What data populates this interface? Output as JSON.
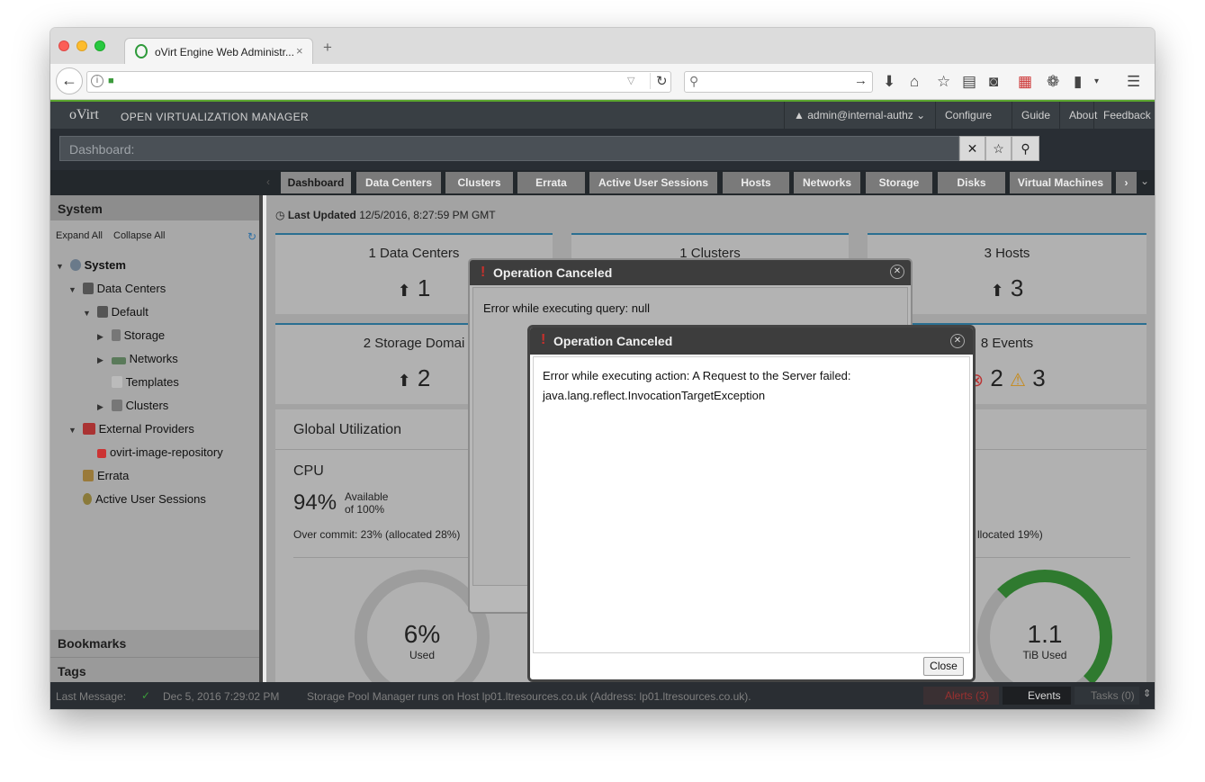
{
  "browser": {
    "tab_title": "oVirt Engine Web Administr...",
    "tab_close": "×",
    "new_tab": "+",
    "reload": "C"
  },
  "header": {
    "logo": "oVirt",
    "title": "OPEN VIRTUALIZATION MANAGER",
    "user": "admin@internal-authz",
    "links": [
      "Configure",
      "Guide",
      "About",
      "Feedback"
    ]
  },
  "search": {
    "placeholder": "Dashboard:"
  },
  "main_tabs": [
    "Dashboard",
    "Data Centers",
    "Clusters",
    "Errata",
    "Active User Sessions",
    "Hosts",
    "Networks",
    "Storage",
    "Disks",
    "Virtual Machines"
  ],
  "sidebar": {
    "title": "System",
    "expand_all": "Expand All",
    "collapse_all": "Collapse All",
    "tree": [
      {
        "label": "System",
        "level": 0,
        "expand": "▼"
      },
      {
        "label": "Data Centers",
        "level": 1,
        "expand": "▼"
      },
      {
        "label": "Default",
        "level": 2,
        "expand": "▼"
      },
      {
        "label": "Storage",
        "level": 3,
        "expand": "▶"
      },
      {
        "label": "Networks",
        "level": 3,
        "expand": "▶"
      },
      {
        "label": "Templates",
        "level": 3,
        "expand": ""
      },
      {
        "label": "Clusters",
        "level": 3,
        "expand": "▶"
      },
      {
        "label": "External Providers",
        "level": 1,
        "expand": "▼"
      },
      {
        "label": "ovirt-image-repository",
        "level": 2,
        "expand": ""
      },
      {
        "label": "Errata",
        "level": 1,
        "expand": ""
      },
      {
        "label": "Active User Sessions",
        "level": 1,
        "expand": ""
      }
    ],
    "bookmarks": "Bookmarks",
    "tags": "Tags"
  },
  "dashboard": {
    "last_updated_label": "Last Updated",
    "last_updated_value": "12/5/2016, 8:27:59 PM GMT",
    "cards": {
      "data_centers": {
        "title": "1 Data Centers",
        "value": "1"
      },
      "clusters": {
        "title": "1 Clusters"
      },
      "hosts": {
        "title": "3 Hosts",
        "value": "3"
      },
      "storage": {
        "title": "2 Storage Domai",
        "value": "2"
      },
      "events": {
        "title": "8 Events",
        "errors": "2",
        "warnings": "3"
      }
    },
    "global_utilization": "Global Utilization",
    "cpu": {
      "label": "CPU",
      "percent": "94%",
      "available": "Available",
      "of_total": "of 100%",
      "overcommit": "Over commit: 23% (allocated 28%)",
      "used_value": "6%",
      "used_label": "Used"
    },
    "storage_util": {
      "overcommit": "llocated 19%)",
      "used_value": "1.1",
      "used_label": "TiB Used"
    }
  },
  "statusbar": {
    "last_message_label": "Last Message:",
    "timestamp": "Dec 5, 2016 7:29:02 PM",
    "message": "Storage Pool Manager runs on Host lp01.ltresources.co.uk (Address: lp01.ltresources.co.uk).",
    "alerts": "Alerts (3)",
    "events": "Events",
    "tasks": "Tasks (0)"
  },
  "dialog_back": {
    "title": "Operation Canceled",
    "message": "Error while executing query: null"
  },
  "dialog_front": {
    "title": "Operation Canceled",
    "message_line1": "Error while executing action: A Request to the Server failed:",
    "message_line2": "java.lang.reflect.InvocationTargetException",
    "close_button": "Close"
  },
  "icons": {
    "warning_mark": "!",
    "close_circle": "✕"
  },
  "colors": {
    "ovirt_green": "#5aa52d",
    "error_red": "#c9302c",
    "header_dark": "#393f44"
  }
}
